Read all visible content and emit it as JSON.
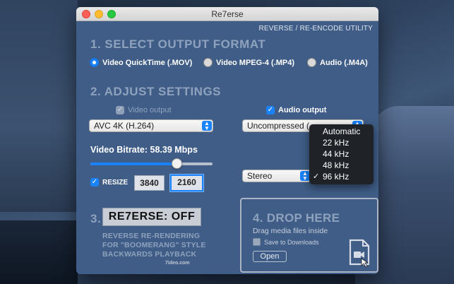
{
  "app": {
    "title": "Re7erse",
    "subtitle": "REVERSE / RE-ENCODE UTILITY"
  },
  "section1": {
    "title": "1. SELECT OUTPUT FORMAT",
    "options": [
      {
        "label": "Video QuickTime (.MOV)",
        "selected": true
      },
      {
        "label": "Video MPEG-4 (.MP4)",
        "selected": false
      },
      {
        "label": "Audio (.M4A)",
        "selected": false
      }
    ]
  },
  "section2": {
    "title": "2. ADJUST SETTINGS",
    "video_output_label": "Video output",
    "audio_output_label": "Audio output",
    "codec_value": "AVC 4K (H.264)",
    "audio_codec_value": "Uncompressed (",
    "bitrate_label": "Video Bitrate: 58.39 Mbps",
    "bitrate_fraction": 0.71,
    "resize_label": "RESIZE",
    "width_value": "3840",
    "height_value": "2160",
    "channels_value": "Stereo"
  },
  "sample_rate_menu": {
    "items": [
      "Automatic",
      "22 kHz",
      "44 kHz",
      "48 kHz",
      "96 kHz"
    ],
    "checked": "96 kHz"
  },
  "section3": {
    "prefix": "3.",
    "button_label": "RE7ERSE: OFF",
    "desc_lines": [
      "REVERSE RE-RENDERING",
      "FOR \"BOOMERANG\" STYLE",
      "BACKWARDS PLAYBACK"
    ],
    "credit": "7ideo.com"
  },
  "dropzone": {
    "title": "4. DROP HERE",
    "subtitle": "Drag media files inside",
    "save_label": "Save to Downloads",
    "open_label": "Open"
  }
}
